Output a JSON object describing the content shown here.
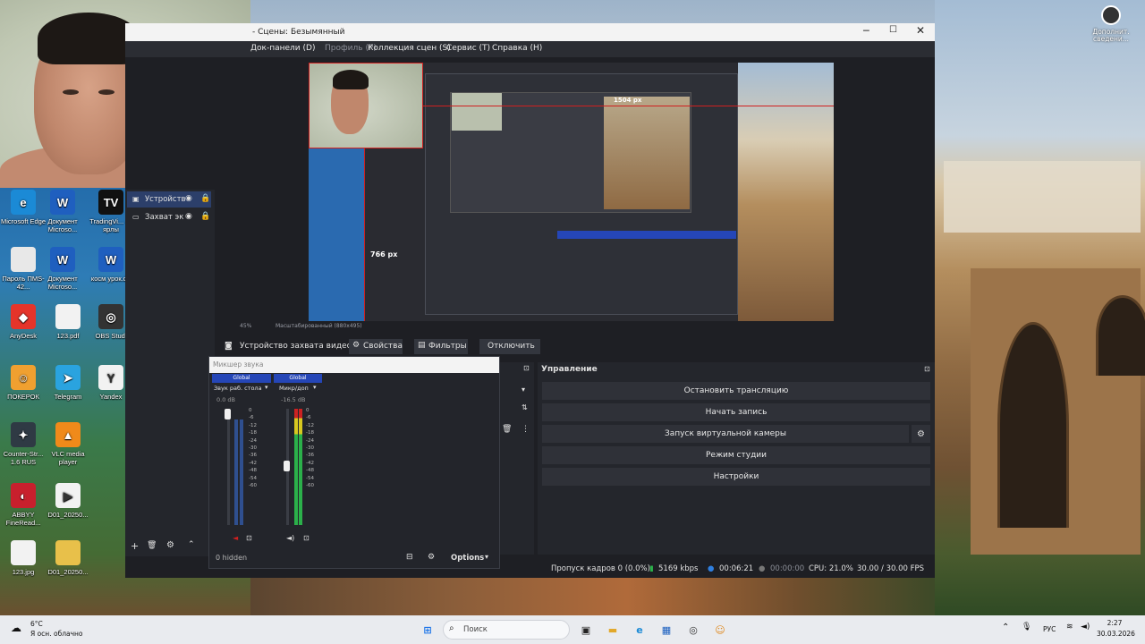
{
  "window": {
    "title": "- Сцены: Безымянный"
  },
  "menu": [
    "Док-панели (D)",
    "Профиль (P)",
    "Коллекция сцен (S)",
    "Сервис (T)",
    "Справка (H)"
  ],
  "preview": {
    "dim_h": "1504 px",
    "dim_v": "766 px",
    "zoom": "45%",
    "scale": "Масштабированный (880x495)"
  },
  "sources": [
    {
      "label": "Устройств"
    },
    {
      "label": "Захват эк"
    }
  ],
  "source_toolbar": {
    "device_label": "Устройство захвата видео",
    "properties": "Свойства",
    "filters": "Фильтры",
    "deactivate": "Отключить"
  },
  "mixer": {
    "title": "Микшер звука",
    "channels": [
      {
        "tag": "Global",
        "name": "Звук раб. стола",
        "db": "0.0 dB"
      },
      {
        "tag": "Global",
        "name": "Микр/доп",
        "db": "-16.5 dB"
      }
    ],
    "scale": [
      "0",
      "-6",
      "-12",
      "-18",
      "-24",
      "-30",
      "-36",
      "-42",
      "-48",
      "-54",
      "-60"
    ],
    "hidden": "0 hidden",
    "options": "Options"
  },
  "controls": {
    "title": "Управление",
    "stop_stream": "Остановить трансляцию",
    "start_record": "Начать запись",
    "virtual_cam": "Запуск виртуальной камеры",
    "studio_mode": "Режим студии",
    "settings": "Настройки"
  },
  "status": {
    "dropped": "Пропуск кадров 0 (0.0%)",
    "bitrate": "5169 kbps",
    "stream_time": "00:06:21",
    "rec_time": "00:00:00",
    "cpu": "CPU: 21.0%",
    "fps": "30.00 / 30.00 FPS"
  },
  "desktop_icons": [
    {
      "label": "Microsoft Edge",
      "color": "#1b8ad6",
      "glyph": "e"
    },
    {
      "label": "Документ Microso...",
      "color": "#1f5fbf",
      "glyph": "W"
    },
    {
      "label": "TradingVi... — ярлы",
      "color": "#111111",
      "glyph": "TV"
    },
    {
      "label": "Пароль ПМS-42...",
      "color": "#e8e8e8",
      "glyph": ""
    },
    {
      "label": "Документ Microso...",
      "color": "#1f5fbf",
      "glyph": "W"
    },
    {
      "label": "косм урок.do",
      "color": "#1f5fbf",
      "glyph": "W"
    },
    {
      "label": "AnyDesk",
      "color": "#e5342a",
      "glyph": "◆"
    },
    {
      "label": "123.pdf",
      "color": "#f2f2f2",
      "glyph": ""
    },
    {
      "label": "OBS Studi",
      "color": "#333333",
      "glyph": "◎"
    },
    {
      "label": "ПОКЕРОК",
      "color": "#f0a030",
      "glyph": "☺"
    },
    {
      "label": "Telegram",
      "color": "#2aa3df",
      "glyph": "➤"
    },
    {
      "label": "Yandex",
      "color": "#f2f2f2",
      "glyph": "Y"
    },
    {
      "label": "Counter-Str... 1.6 RUS",
      "color": "#2f3a44",
      "glyph": "✦"
    },
    {
      "label": "VLC media player",
      "color": "#f08a1a",
      "glyph": "▲"
    },
    {
      "label": "ABBYY FineRead...",
      "color": "#c8202d",
      "glyph": "◐"
    },
    {
      "label": "D01_20250...",
      "color": "#f2f2f2",
      "glyph": "▶"
    },
    {
      "label": "123.jpg",
      "color": "#f2f2f2",
      "glyph": ""
    },
    {
      "label": "D01_20250...",
      "color": "#e8c04a",
      "glyph": ""
    }
  ],
  "notification": {
    "label": "Дополнит. сведени..."
  },
  "taskbar": {
    "weather_temp": "6°C",
    "weather_text": "Я осн. облачно",
    "search_placeholder": "Поиск",
    "lang": "РУС",
    "time": "2:27",
    "date": "30.03.2026"
  }
}
